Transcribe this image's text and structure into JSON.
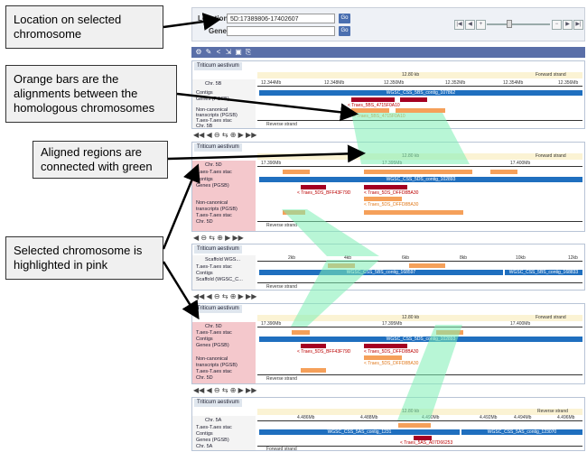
{
  "callouts": {
    "location": "Location on selected chromosome",
    "orange": "Orange bars are the alignments between the homologous chromosomes",
    "green": "Aligned regions are connected with green",
    "pink": "Selected chromosome is highlighted in pink"
  },
  "search": {
    "location_label": "Location:",
    "location_value": "5D:17389806-17402607",
    "gene_label": "Gene:",
    "gene_value": "",
    "go": "Go"
  },
  "toolbar_icons": [
    "gear-icon",
    "settings-icon",
    "share-icon",
    "export-icon",
    "image-icon",
    "link-icon"
  ],
  "colors": {
    "selected": "#f4c8cc",
    "contig": "#1f6fbf",
    "gene": "#a40022",
    "alignment": "#f5a05a",
    "connector": "#7deeb4"
  },
  "panels": [
    {
      "species": "Triticum aestivum",
      "chr": "Chr. 5B",
      "rows": [
        "Contigs",
        "Genes (PGSB)",
        "",
        "Non-canonical",
        "transcripts (PGSB)",
        "T.aes-T.aes stac",
        "Chr. 5B"
      ],
      "scale": "12.80 kb",
      "strand_fwd": "Forward strand",
      "strand_rev": "Reverse strand",
      "ticks": [
        "12.344Mb",
        "12.348Mb",
        "12.350Mb",
        "12.352Mb",
        "12.354Mb",
        "12.356Mb"
      ],
      "contig": "WGSC_CSS_5BS_contig_107862",
      "gene1": "< Traes_5BS_4715F0A10",
      "gene2": "< Traes_5BS_4715F0A10"
    },
    {
      "species": "Triticum aestivum",
      "chr": "Chr. 5D",
      "rows": [
        "T.aes-T.aes stac",
        "Contigs",
        "Genes (PGSB)",
        "",
        "Non-canonical",
        "transcripts (PGSB)",
        "T.aes-T.aes stac",
        "Chr. 5D"
      ],
      "scale": "12.80 kb",
      "strand_fwd": "Forward strand",
      "strand_rev": "Reverse strand",
      "ticks": [
        "17.390Mb",
        "17.395Mb",
        "17.400Mb"
      ],
      "contig": "WGSC_CSS_5DS_contig_102893",
      "gene1": "< Traes_5DS_BFF43F79D",
      "gene2": "< Traes_5DS_DFFD8BA30",
      "gene3": "< Traes_5DS_DFFD8BA30"
    },
    {
      "species": "Triticum aestivum",
      "chr": "Scaffold WGS...",
      "rows": [
        "T.aes-T.aes stac",
        "Contigs",
        "Scaffold (WGSC_C..."
      ],
      "scale": "12.80 kb",
      "strand_fwd": "Forward strand",
      "strand_rev": "Reverse strand",
      "ticks": [
        "2kb",
        "4kb",
        "6kb",
        "8kb",
        "10kb",
        "12kb"
      ],
      "contig": "WGSC_CSS_5BS_contig_168597",
      "contig2": "WGSC_CSS_5BS_contig_168833"
    },
    {
      "species": "Triticum aestivum",
      "chr": "Chr. 5D",
      "rows": [
        "T.aes-T.aes stac",
        "Contigs",
        "Genes (PGSB)",
        "",
        "Non-canonical",
        "transcripts (PGSB)",
        "T.aes-T.aes stac",
        "Chr. 5D"
      ],
      "scale": "12.80 kb",
      "strand_fwd": "Forward strand",
      "strand_rev": "Reverse strand",
      "ticks": [
        "17.390Mb",
        "17.395Mb",
        "17.400Mb"
      ],
      "contig": "WGSC_CSS_5DS_contig_102893",
      "gene1": "< Traes_5DS_BFF43F79D",
      "gene2": "< Traes_5DS_DFFD8BA30",
      "gene3": "< Traes_5DS_DFFD8BA30"
    },
    {
      "species": "Triticum aestivum",
      "chr": "Chr. 5A",
      "rows": [
        "T.aes-T.aes stac",
        "Contigs",
        "Genes (PGSB)",
        "Chr. 5A"
      ],
      "scale": "12.80 kb",
      "strand_fwd": "Forward strand",
      "strand_rev": "Reverse strand",
      "ticks": [
        "4.486Mb",
        "4.488Mb",
        "4.490Mb",
        "4.492Mb",
        "4.494Mb",
        "4.496Mb"
      ],
      "contig": "WGSC_CSS_5AS_contig_1231",
      "contig2": "WGSC_CSS_5AS_contig_123070",
      "gene1": "< Traes_5AS_A07D66253"
    }
  ]
}
